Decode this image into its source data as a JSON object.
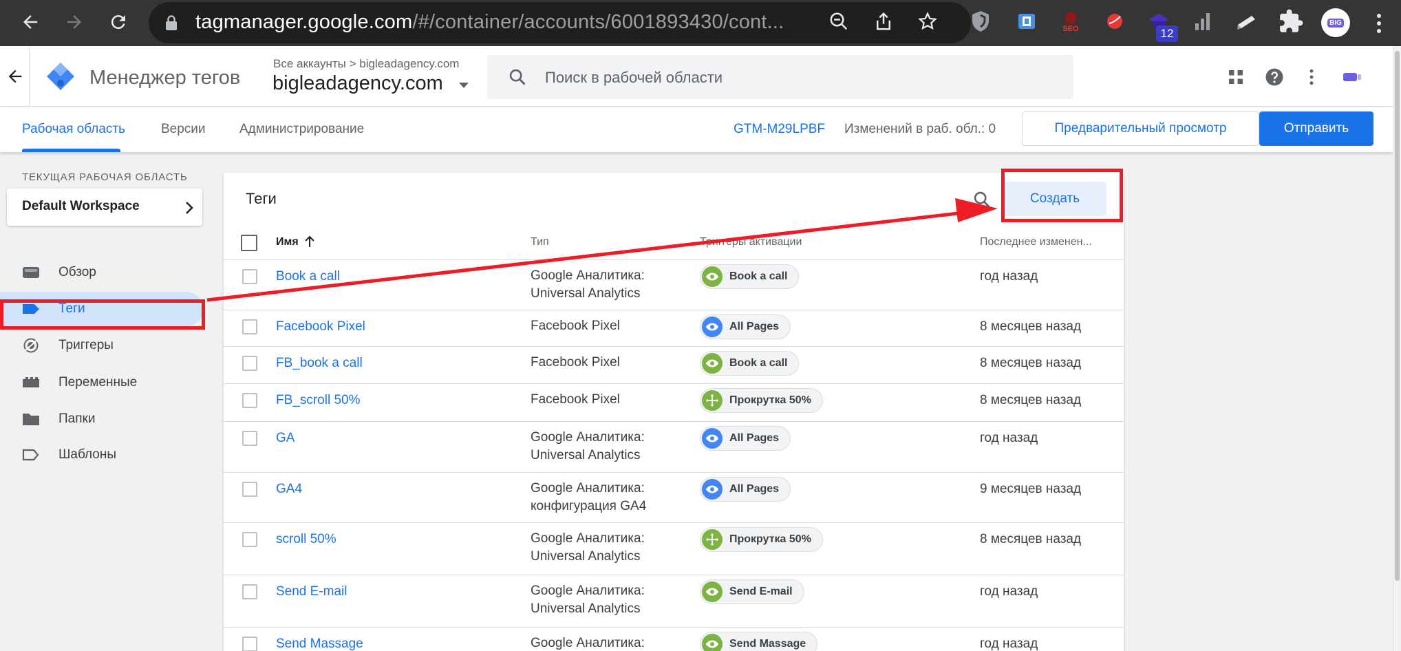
{
  "browser": {
    "url_host": "tagmanager.google.com",
    "url_path": "/#/container/accounts/6001893430/cont...",
    "extensions": [
      "shield-extension-icon",
      "dark-reader-extension-icon",
      "seo-extension-icon",
      "red-circle-extension-icon",
      "purple-extension-icon",
      "bars-extension-icon",
      "pencil-extension-icon",
      "puzzle-extensions-icon"
    ],
    "extension_badge": "12",
    "profile_label": "BIG"
  },
  "header": {
    "product_name": "Менеджер тегов",
    "account_crumb": "Все аккаунты > bigleadagency.com",
    "container_name": "bigleadagency.com",
    "search_placeholder": "Поиск в рабочей области"
  },
  "tabs": {
    "workspace": "Рабочая область",
    "versions": "Версии",
    "admin": "Администрирование",
    "container_id": "GTM-M29LPBF",
    "changes": "Изменений в раб. обл.: 0",
    "preview": "Предварительный просмотр",
    "submit": "Отправить"
  },
  "sidebar": {
    "workspace_label": "ТЕКУЩАЯ РАБОЧАЯ ОБЛАСТЬ",
    "workspace_name": "Default Workspace",
    "items": [
      {
        "label": "Обзор",
        "icon": "overview-icon"
      },
      {
        "label": "Теги",
        "icon": "tag-icon",
        "active": true
      },
      {
        "label": "Триггеры",
        "icon": "trigger-icon"
      },
      {
        "label": "Переменные",
        "icon": "variables-icon"
      },
      {
        "label": "Папки",
        "icon": "folder-icon"
      },
      {
        "label": "Шаблоны",
        "icon": "template-icon"
      }
    ]
  },
  "tags": {
    "title": "Теги",
    "create": "Создать",
    "columns": {
      "name": "Имя",
      "type": "Тип",
      "triggers": "Триггеры активации",
      "modified": "Последнее изменен..."
    },
    "rows": [
      {
        "name": "Book a call",
        "type": "Google Аналитика: Universal Analytics",
        "trigger": "Book a call",
        "trigger_kind": "eye",
        "modified": "год назад"
      },
      {
        "name": "Facebook Pixel",
        "type": "Facebook Pixel",
        "trigger": "All Pages",
        "trigger_kind": "eye-blue",
        "modified": "8 месяцев назад"
      },
      {
        "name": "FB_book a call",
        "type": "Facebook Pixel",
        "trigger": "Book a call",
        "trigger_kind": "eye",
        "modified": "8 месяцев назад"
      },
      {
        "name": "FB_scroll 50%",
        "type": "Facebook Pixel",
        "trigger": "Прокрутка 50%",
        "trigger_kind": "move",
        "modified": "8 месяцев назад"
      },
      {
        "name": "GA",
        "type": "Google Аналитика: Universal Analytics",
        "trigger": "All Pages",
        "trigger_kind": "eye-blue",
        "modified": "год назад"
      },
      {
        "name": "GA4",
        "type": "Google Аналитика: конфигурация GA4",
        "trigger": "All Pages",
        "trigger_kind": "eye-blue",
        "modified": "9 месяцев назад"
      },
      {
        "name": "scroll 50%",
        "type": "Google Аналитика: Universal Analytics",
        "trigger": "Прокрутка 50%",
        "trigger_kind": "move",
        "modified": "8 месяцев назад"
      },
      {
        "name": "Send E-mail",
        "type": "Google Аналитика: Universal Analytics",
        "trigger": "Send E-mail",
        "trigger_kind": "eye",
        "modified": "год назад"
      },
      {
        "name": "Send Massage",
        "type": "Google Аналитика:",
        "trigger": "Send Massage",
        "trigger_kind": "eye",
        "modified": "год назад"
      }
    ]
  },
  "colors": {
    "accent": "#1a73e8",
    "annotation": "#ee1c25",
    "trigger_green": "#7cb342",
    "trigger_blue": "#4285f4"
  }
}
